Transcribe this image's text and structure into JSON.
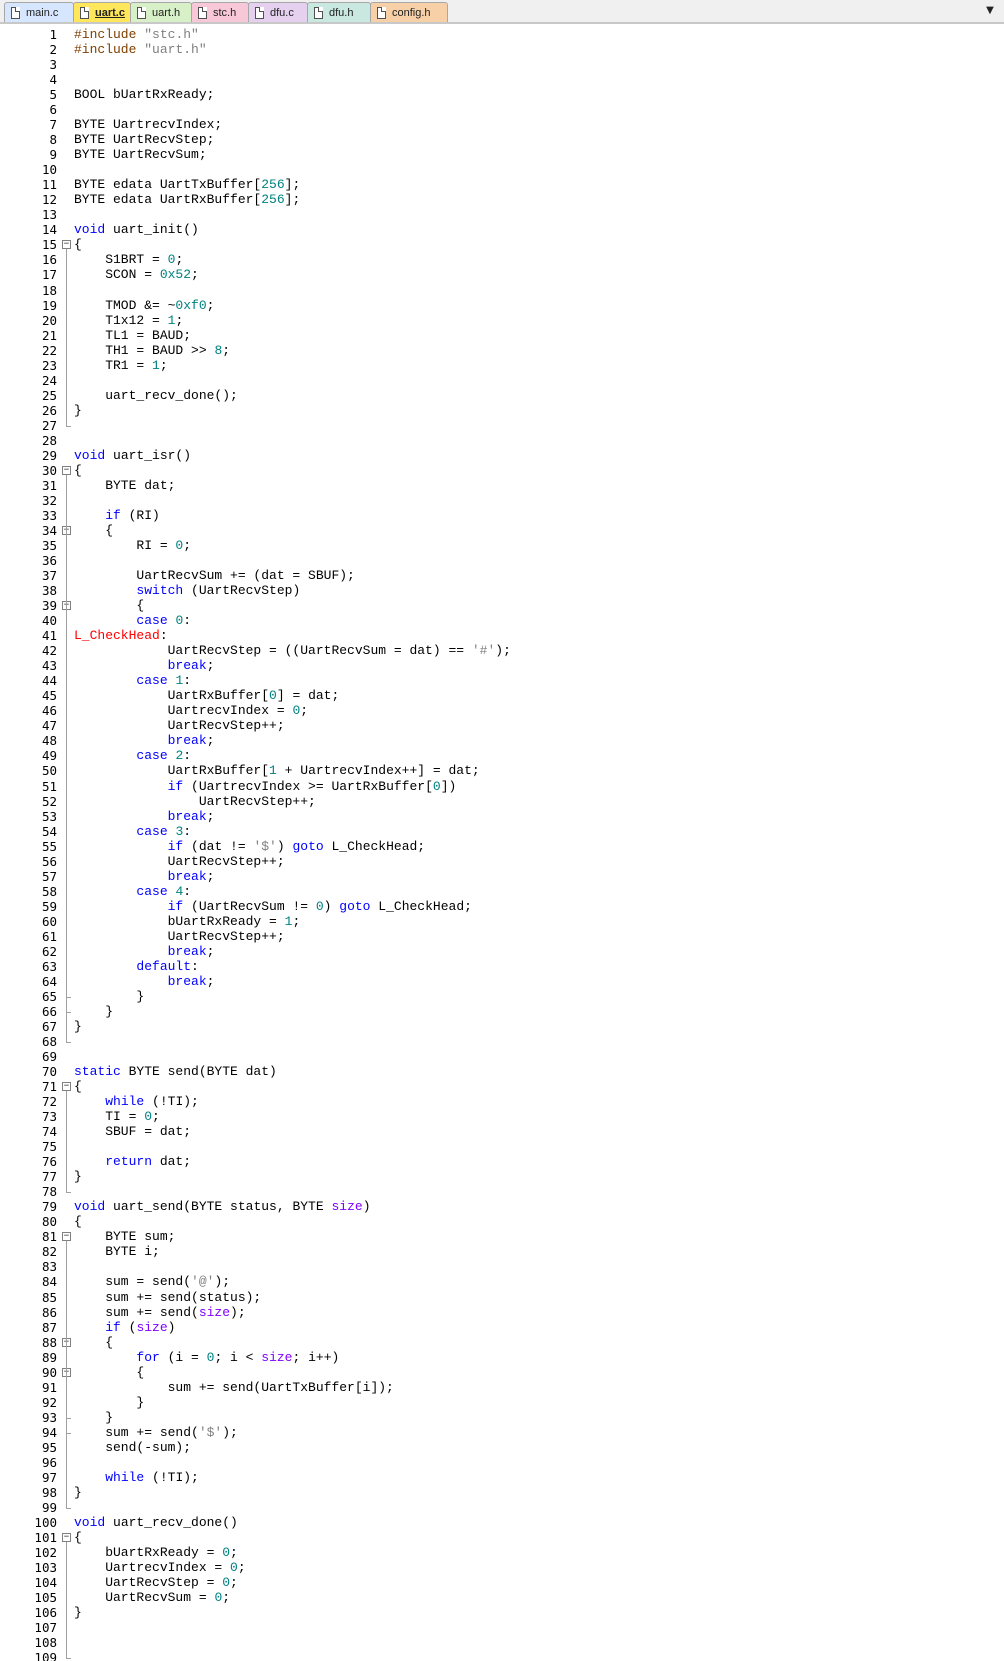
{
  "tabs": [
    {
      "label": "main.c",
      "color": "#d6e6ff",
      "active": false
    },
    {
      "label": "uart.c",
      "color": "#ffe65a",
      "active": true
    },
    {
      "label": "uart.h",
      "color": "#d8f0c8",
      "active": false
    },
    {
      "label": "stc.h",
      "color": "#f8c8d8",
      "active": false
    },
    {
      "label": "dfu.c",
      "color": "#e6d0f0",
      "active": false
    },
    {
      "label": "dfu.h",
      "color": "#c8e8e0",
      "active": false
    },
    {
      "label": "config.h",
      "color": "#f8d0a8",
      "active": false
    }
  ],
  "scroll_icon": "chevron-down-icon",
  "code_lines": [
    "#include \"stc.h\"",
    "#include \"uart.h\"",
    "",
    "",
    "BOOL bUartRxReady;",
    "",
    "BYTE UartrecvIndex;",
    "BYTE UartRecvStep;",
    "BYTE UartRecvSum;",
    "",
    "BYTE edata UartTxBuffer[256];",
    "BYTE edata UartRxBuffer[256];",
    "",
    "void uart_init()",
    "{",
    "    S1BRT = 0;",
    "    SCON = 0x52;",
    "",
    "    TMOD &= ~0xf0;",
    "    T1x12 = 1;",
    "    TL1 = BAUD;",
    "    TH1 = BAUD >> 8;",
    "    TR1 = 1;",
    "",
    "    uart_recv_done();",
    "}",
    "",
    "",
    "void uart_isr()",
    "{",
    "    BYTE dat;",
    "",
    "    if (RI)",
    "    {",
    "        RI = 0;",
    "",
    "        UartRecvSum += (dat = SBUF);",
    "        switch (UartRecvStep)",
    "        {",
    "        case 0:",
    "L_CheckHead:",
    "            UartRecvStep = ((UartRecvSum = dat) == '#');",
    "            break;",
    "        case 1:",
    "            UartRxBuffer[0] = dat;",
    "            UartrecvIndex = 0;",
    "            UartRecvStep++;",
    "            break;",
    "        case 2:",
    "            UartRxBuffer[1 + UartrecvIndex++] = dat;",
    "            if (UartrecvIndex >= UartRxBuffer[0])",
    "                UartRecvStep++;",
    "            break;",
    "        case 3:",
    "            if (dat != '$') goto L_CheckHead;",
    "            UartRecvStep++;",
    "            break;",
    "        case 4:",
    "            if (UartRecvSum != 0) goto L_CheckHead;",
    "            bUartRxReady = 1;",
    "            UartRecvStep++;",
    "            break;",
    "        default:",
    "            break;",
    "        }",
    "    }",
    "}",
    "",
    "",
    "static BYTE send(BYTE dat)",
    "{",
    "    while (!TI);",
    "    TI = 0;",
    "    SBUF = dat;",
    "",
    "    return dat;",
    "}",
    "",
    "void uart_send(BYTE status, BYTE size)",
    "{",
    "    BYTE sum;",
    "    BYTE i;",
    "",
    "    sum = send('@');",
    "    sum += send(status);",
    "    sum += send(size);",
    "    if (size)",
    "    {",
    "        for (i = 0; i < size; i++)",
    "        {",
    "            sum += send(UartTxBuffer[i]);",
    "        }",
    "    }",
    "    sum += send('$');",
    "    send(-sum);",
    "",
    "    while (!TI);",
    "}",
    "",
    "void uart_recv_done()",
    "{",
    "    bUartRxReady = 0;",
    "    UartrecvIndex = 0;",
    "    UartRecvStep = 0;",
    "    UartRecvSum = 0;",
    "}",
    "",
    "",
    ""
  ],
  "fold_lines": [
    15,
    30,
    34,
    39,
    71,
    81,
    88,
    90,
    101
  ],
  "syntax_colors": {
    "keyword": "#0000ff",
    "preprocessor": "#804000",
    "string": "#808080",
    "number": "#008080",
    "label": "#ff0000",
    "type_param": "#8000ff"
  }
}
